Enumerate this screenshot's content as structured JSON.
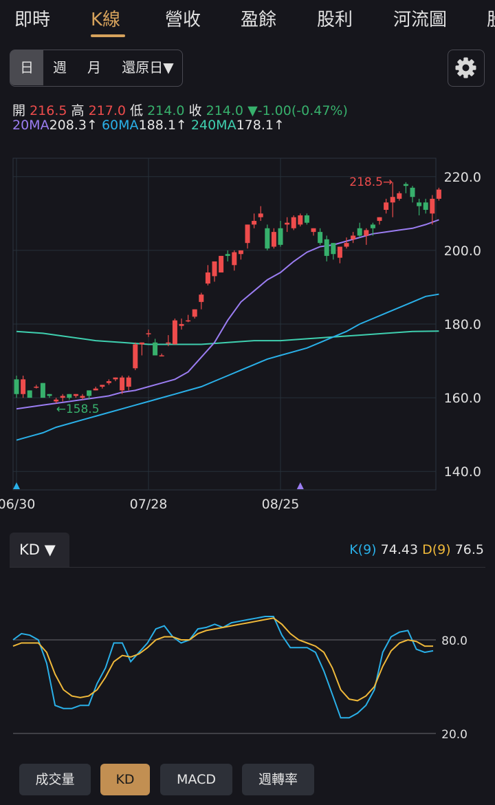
{
  "tabs": [
    "即時",
    "K線",
    "營收",
    "盈餘",
    "股利",
    "河流圖",
    "股"
  ],
  "periods": [
    "日",
    "週",
    "月",
    "還原日▼"
  ],
  "settings_icon": "gear-icon",
  "quote": {
    "open_label": "開",
    "open": "216.5",
    "high_label": "高",
    "high": "217.0",
    "low_label": "低",
    "low": "214.0",
    "close_label": "收",
    "close": "214.0",
    "change": "▼-1.00(-0.47%)"
  },
  "ma": {
    "ma20_label": "20MA",
    "ma20": "208.3↑",
    "ma60_label": "60MA",
    "ma60": "188.1↑",
    "ma240_label": "240MA",
    "ma240": "178.1↑"
  },
  "colors": {
    "up": "#ee4c4c",
    "down": "#37b06c",
    "ma20": "#9b7df2",
    "ma60": "#2ab0e8",
    "ma240": "#3fd0b0",
    "k": "#2ab0e8",
    "d": "#f0b93a",
    "accent": "#d6a25c"
  },
  "chart_data": [
    {
      "type": "candlestick",
      "y_ticks": [
        "220.0",
        "200.0",
        "180.0",
        "160.0",
        "140.0"
      ],
      "ylim": [
        135,
        225
      ],
      "x_ticks": [
        {
          "label": "06/30",
          "index": 0
        },
        {
          "label": "07/28",
          "index": 20
        },
        {
          "label": "08/25",
          "index": 40
        }
      ],
      "candles": [
        [
          165,
          166,
          160,
          161
        ],
        [
          161,
          166,
          160,
          165
        ],
        [
          162,
          162,
          160,
          160
        ],
        [
          163,
          163.5,
          162.5,
          163
        ],
        [
          164,
          164,
          160,
          160
        ],
        [
          161,
          161,
          160,
          160.5
        ],
        [
          159,
          160,
          158.5,
          159.5
        ],
        [
          160,
          161,
          159,
          160.5
        ],
        [
          161,
          161,
          159.5,
          160
        ],
        [
          160.5,
          161,
          160,
          161
        ],
        [
          160,
          161,
          159.5,
          160.5
        ],
        [
          162,
          162,
          159.5,
          160.5
        ],
        [
          162,
          163,
          162,
          162.5
        ],
        [
          163,
          163.5,
          162.5,
          163.5
        ],
        [
          164,
          165,
          163.5,
          164.5
        ],
        [
          165,
          165.5,
          164.5,
          165.5
        ],
        [
          162,
          166,
          161,
          165.5
        ],
        [
          163,
          166,
          162,
          165.5
        ],
        [
          168,
          175,
          167.5,
          174.5
        ],
        [
          174.5,
          175,
          171.5,
          175
        ],
        [
          177.5,
          178.5,
          176.5,
          177.5
        ],
        [
          175,
          176,
          171.5,
          171.5
        ],
        [
          171.5,
          172,
          171.5,
          171.5
        ],
        [
          175,
          177,
          174,
          175
        ],
        [
          174.5,
          181.5,
          174.5,
          181
        ],
        [
          179.5,
          181.5,
          178.5,
          180
        ],
        [
          181,
          182.5,
          180.5,
          181
        ],
        [
          182,
          184,
          181.5,
          184
        ],
        [
          186,
          188.5,
          184,
          188
        ],
        [
          191,
          196,
          190.5,
          194
        ],
        [
          193,
          197,
          191.5,
          197
        ],
        [
          194,
          198.5,
          194,
          198.5
        ],
        [
          199,
          200,
          197,
          198.5
        ],
        [
          196,
          200,
          194.5,
          199.5
        ],
        [
          199,
          200,
          197.5,
          200
        ],
        [
          202,
          207,
          200.5,
          207
        ],
        [
          207,
          210,
          206,
          208
        ],
        [
          209,
          212,
          208,
          210
        ],
        [
          206,
          207,
          200,
          200.5
        ],
        [
          201,
          206,
          200.5,
          205
        ],
        [
          206,
          208,
          201,
          201.5
        ],
        [
          207,
          209,
          205,
          207.5
        ],
        [
          206,
          209.5,
          205.5,
          209
        ],
        [
          207,
          210,
          206.5,
          209.5
        ],
        [
          209.5,
          210,
          207,
          207.5
        ],
        [
          205,
          206,
          204,
          206
        ],
        [
          205,
          206,
          201.5,
          202
        ],
        [
          203,
          204,
          197,
          198.5
        ],
        [
          202,
          202,
          197.5,
          199
        ],
        [
          198,
          201,
          196.5,
          201
        ],
        [
          201,
          203.5,
          200.5,
          202
        ],
        [
          203,
          205,
          202,
          204
        ],
        [
          206,
          207.5,
          203.5,
          204
        ],
        [
          204,
          206,
          201.5,
          205.5
        ],
        [
          207,
          207.5,
          204,
          206
        ],
        [
          208,
          209,
          207,
          209
        ],
        [
          211,
          214,
          210,
          213
        ],
        [
          213,
          218.5,
          209,
          214.5
        ],
        [
          214,
          216,
          213.5,
          215.5
        ],
        [
          218,
          218.5,
          215.5,
          217.5
        ],
        [
          217,
          217.5,
          213,
          214.5
        ],
        [
          213,
          214,
          209.5,
          212
        ],
        [
          213,
          214,
          210,
          211
        ],
        [
          210,
          215,
          207,
          214
        ],
        [
          214,
          217,
          213.5,
          216.5
        ]
      ],
      "ma20": [
        [
          0,
          157
        ],
        [
          2,
          157.5
        ],
        [
          4,
          158
        ],
        [
          6,
          158.5
        ],
        [
          8,
          159
        ],
        [
          10,
          159.5
        ],
        [
          12,
          160
        ],
        [
          14,
          160.5
        ],
        [
          16,
          161.5
        ],
        [
          18,
          162
        ],
        [
          20,
          163
        ],
        [
          22,
          164
        ],
        [
          24,
          165
        ],
        [
          26,
          167
        ],
        [
          28,
          171
        ],
        [
          30,
          175
        ],
        [
          32,
          181
        ],
        [
          34,
          186
        ],
        [
          36,
          189
        ],
        [
          38,
          192
        ],
        [
          40,
          194
        ],
        [
          42,
          197
        ],
        [
          44,
          199.5
        ],
        [
          46,
          201
        ],
        [
          48,
          201.5
        ],
        [
          50,
          202.5
        ],
        [
          52,
          203.5
        ],
        [
          54,
          204.5
        ],
        [
          56,
          205
        ],
        [
          58,
          205.5
        ],
        [
          60,
          206
        ],
        [
          62,
          207
        ],
        [
          64,
          208.3
        ]
      ],
      "ma60": [
        [
          0,
          148.5
        ],
        [
          2,
          149.5
        ],
        [
          4,
          150.5
        ],
        [
          6,
          152
        ],
        [
          8,
          153
        ],
        [
          10,
          154
        ],
        [
          12,
          155
        ],
        [
          14,
          156
        ],
        [
          16,
          157
        ],
        [
          18,
          158
        ],
        [
          20,
          159
        ],
        [
          22,
          160
        ],
        [
          24,
          161
        ],
        [
          26,
          162
        ],
        [
          28,
          163
        ],
        [
          30,
          164.5
        ],
        [
          32,
          166
        ],
        [
          34,
          167.5
        ],
        [
          36,
          169
        ],
        [
          38,
          170.5
        ],
        [
          40,
          171.5
        ],
        [
          42,
          172.5
        ],
        [
          44,
          173.5
        ],
        [
          46,
          175
        ],
        [
          48,
          176.5
        ],
        [
          50,
          178
        ],
        [
          52,
          180
        ],
        [
          54,
          181.5
        ],
        [
          56,
          183
        ],
        [
          58,
          184.5
        ],
        [
          60,
          186
        ],
        [
          62,
          187.5
        ],
        [
          64,
          188.1
        ]
      ],
      "ma240": [
        [
          0,
          178
        ],
        [
          4,
          177.5
        ],
        [
          8,
          176.5
        ],
        [
          12,
          175.5
        ],
        [
          16,
          175
        ],
        [
          20,
          174.5
        ],
        [
          24,
          174.5
        ],
        [
          28,
          174.5
        ],
        [
          32,
          175
        ],
        [
          36,
          175.5
        ],
        [
          40,
          175.5
        ],
        [
          44,
          176
        ],
        [
          48,
          176.5
        ],
        [
          52,
          177
        ],
        [
          56,
          177.5
        ],
        [
          60,
          178
        ],
        [
          64,
          178.1
        ]
      ],
      "annotations": [
        {
          "text": "218.5→",
          "x": 57,
          "y": 218.5,
          "color": "#ee4c4c"
        },
        {
          "text": "←158.5",
          "x": 6,
          "y": 158.5,
          "color": "#37b06c"
        }
      ],
      "markers": [
        {
          "index": 0,
          "color": "#2ab0e8"
        },
        {
          "index": 43,
          "color": "#9b7df2"
        }
      ]
    },
    {
      "type": "line",
      "title": "KD",
      "y_ticks": [
        "80.0",
        "20.0"
      ],
      "ylim": [
        15,
        100
      ],
      "series": [
        {
          "name": "K(9)",
          "values": [
            80,
            84,
            83,
            80,
            65,
            38,
            36,
            36,
            38,
            38,
            52,
            62,
            78,
            78,
            66,
            72,
            78,
            87,
            89,
            82,
            78,
            80,
            87,
            88,
            90,
            88,
            91,
            92,
            93,
            94,
            95,
            95,
            83,
            75,
            75,
            75,
            72,
            60,
            45,
            30,
            30,
            33,
            38,
            48,
            72,
            82,
            85,
            86,
            74,
            72,
            73
          ]
        },
        {
          "name": "D(9)",
          "values": [
            76,
            78,
            78,
            78,
            72,
            58,
            48,
            44,
            43,
            44,
            48,
            56,
            66,
            70,
            69,
            71,
            75,
            80,
            82,
            82,
            80,
            80,
            84,
            86,
            87,
            88,
            89,
            90,
            91,
            92,
            93,
            94,
            90,
            84,
            80,
            78,
            76,
            72,
            62,
            48,
            42,
            41,
            44,
            50,
            63,
            73,
            78,
            80,
            79,
            76,
            76
          ]
        }
      ]
    }
  ],
  "kd_legend": {
    "k_label": "K(9)",
    "k_value": "74.43",
    "d_label": "D(9)",
    "d_value": "76.5"
  },
  "indicator_selector": "KD ▼",
  "bottom_buttons": [
    "成交量",
    "KD",
    "MACD",
    "週轉率"
  ]
}
